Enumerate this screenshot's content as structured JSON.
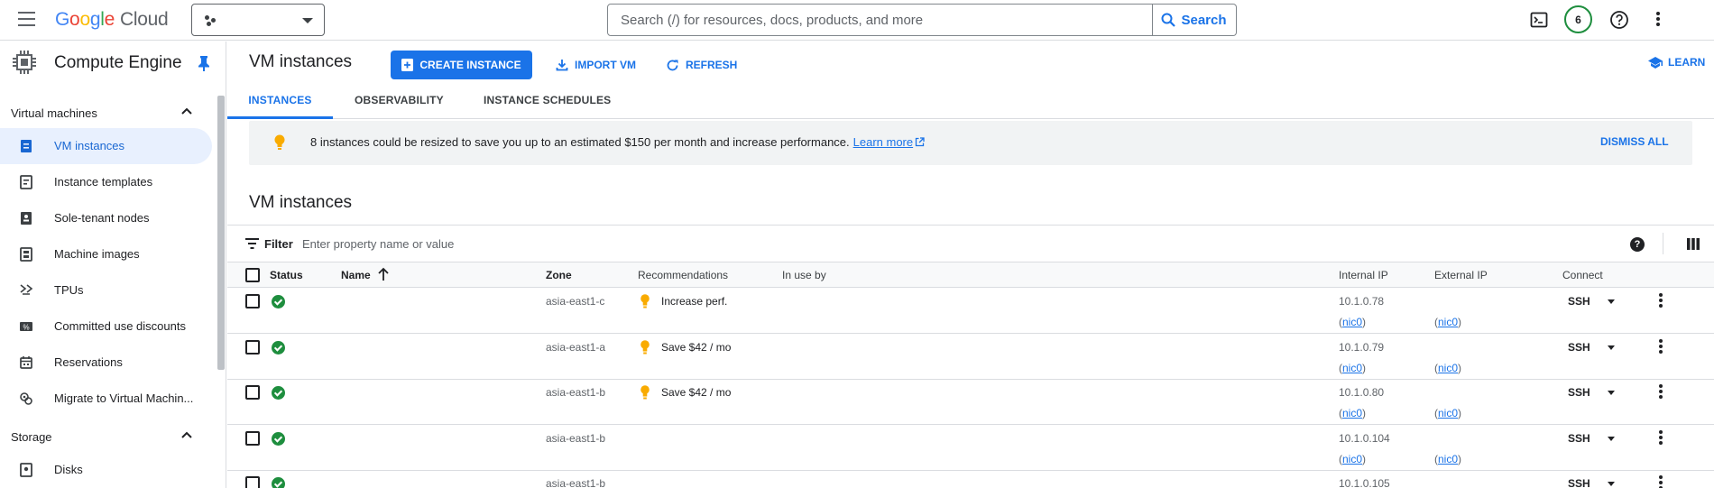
{
  "header": {
    "logo_google": "Google",
    "logo_cloud": "Cloud",
    "search_placeholder": "Search (/) for resources, docs, products, and more",
    "search_button": "Search",
    "notifications_count": "6",
    "icons": [
      "menu-icon",
      "project-icon",
      "terminal-icon",
      "help-icon",
      "more-vert-icon"
    ]
  },
  "sidebar": {
    "product_title": "Compute Engine",
    "sections": [
      {
        "label": "Virtual machines",
        "items": [
          {
            "label": "VM instances",
            "icon": "vm-instances-icon",
            "active": true
          },
          {
            "label": "Instance templates",
            "icon": "template-icon"
          },
          {
            "label": "Sole-tenant nodes",
            "icon": "sole-tenant-icon"
          },
          {
            "label": "Machine images",
            "icon": "machine-image-icon"
          },
          {
            "label": "TPUs",
            "icon": "tpu-icon"
          },
          {
            "label": "Committed use discounts",
            "icon": "discount-icon"
          },
          {
            "label": "Reservations",
            "icon": "reservations-icon"
          },
          {
            "label": "Migrate to Virtual Machin...",
            "icon": "migrate-icon"
          }
        ]
      },
      {
        "label": "Storage",
        "items": [
          {
            "label": "Disks",
            "icon": "disk-icon"
          }
        ]
      }
    ]
  },
  "toolbar": {
    "page_title": "VM instances",
    "create_label": "CREATE INSTANCE",
    "import_label": "IMPORT VM",
    "refresh_label": "REFRESH",
    "learn_label": "LEARN"
  },
  "tabs": [
    {
      "label": "INSTANCES",
      "active": true
    },
    {
      "label": "OBSERVABILITY"
    },
    {
      "label": "INSTANCE SCHEDULES"
    }
  ],
  "banner": {
    "text": "8 instances could be resized to save you up to an estimated $150 per month and increase performance.",
    "link": "Learn more",
    "dismiss": "DISMISS ALL"
  },
  "instances": {
    "title": "VM instances",
    "filter_label": "Filter",
    "filter_placeholder": "Enter property name or value",
    "help_glyph": "?",
    "columns": [
      "Status",
      "Name",
      "Zone",
      "Recommendations",
      "In use by",
      "Internal IP",
      "External IP",
      "Connect"
    ],
    "rows": [
      {
        "zone": "asia-east1-c",
        "recommendation": "Increase perf.",
        "internal_ip": "10.1.0.78",
        "nic_internal": "nic0",
        "nic_external": "nic0",
        "connect": "SSH"
      },
      {
        "zone": "asia-east1-a",
        "recommendation": "Save $42 / mo",
        "internal_ip": "10.1.0.79",
        "nic_internal": "nic0",
        "nic_external": "nic0",
        "connect": "SSH"
      },
      {
        "zone": "asia-east1-b",
        "recommendation": "Save $42 / mo",
        "internal_ip": "10.1.0.80",
        "nic_internal": "nic0",
        "nic_external": "nic0",
        "connect": "SSH"
      },
      {
        "zone": "asia-east1-b",
        "recommendation": "",
        "internal_ip": "10.1.0.104",
        "nic_internal": "nic0",
        "nic_external": "nic0",
        "connect": "SSH"
      },
      {
        "zone": "asia-east1-b",
        "recommendation": "",
        "internal_ip": "10.1.0.105",
        "nic_internal": "",
        "nic_external": "",
        "connect": "SSH"
      }
    ]
  },
  "colors": {
    "accent": "#1a73e8",
    "status_ok": "#1e8e3e",
    "recommendation_bulb": "#f9ab00",
    "active_nav_bg": "#e8f0fe"
  }
}
